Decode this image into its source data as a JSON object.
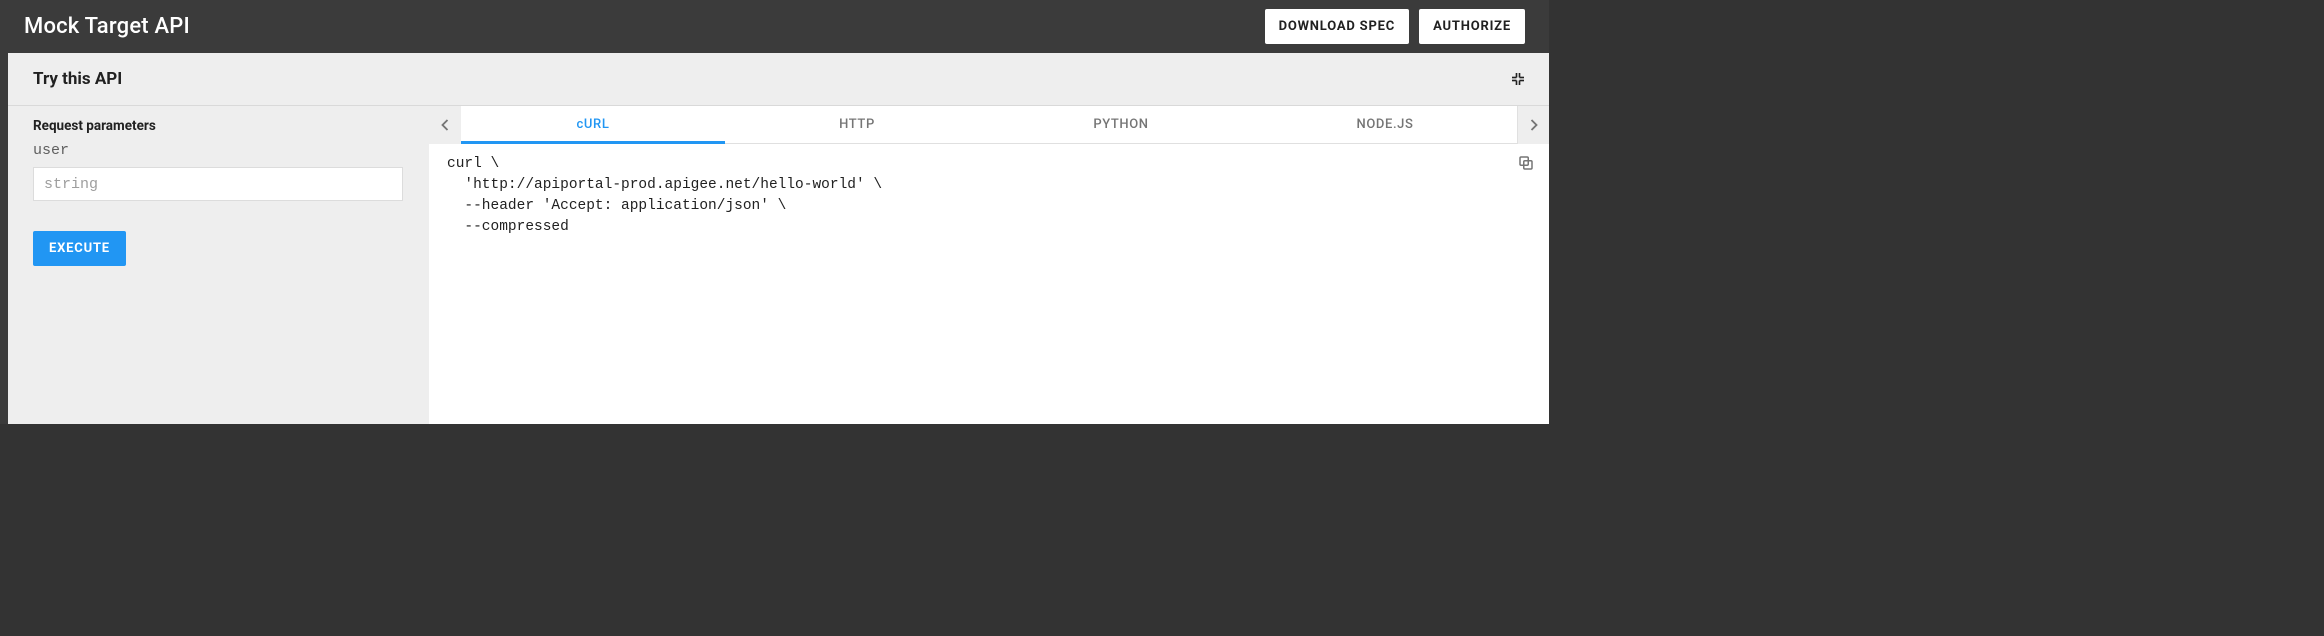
{
  "header": {
    "title": "Mock Target API",
    "download_label": "DOWNLOAD SPEC",
    "authorize_label": "AUTHORIZE"
  },
  "panel": {
    "title": "Try this API"
  },
  "request": {
    "section_label": "Request parameters",
    "params": [
      {
        "name": "user",
        "placeholder": "string",
        "value": ""
      }
    ],
    "execute_label": "EXECUTE"
  },
  "code": {
    "tabs": [
      {
        "label": "cURL",
        "active": true
      },
      {
        "label": "HTTP",
        "active": false
      },
      {
        "label": "PYTHON",
        "active": false
      },
      {
        "label": "NODE.JS",
        "active": false
      }
    ],
    "snippet": "curl \\\n  'http://apiportal-prod.apigee.net/hello-world' \\\n  --header 'Accept: application/json' \\\n  --compressed"
  },
  "colors": {
    "accent": "#2196f3",
    "header_bg": "#3b3b3b",
    "panel_bg": "#eeeeee"
  }
}
